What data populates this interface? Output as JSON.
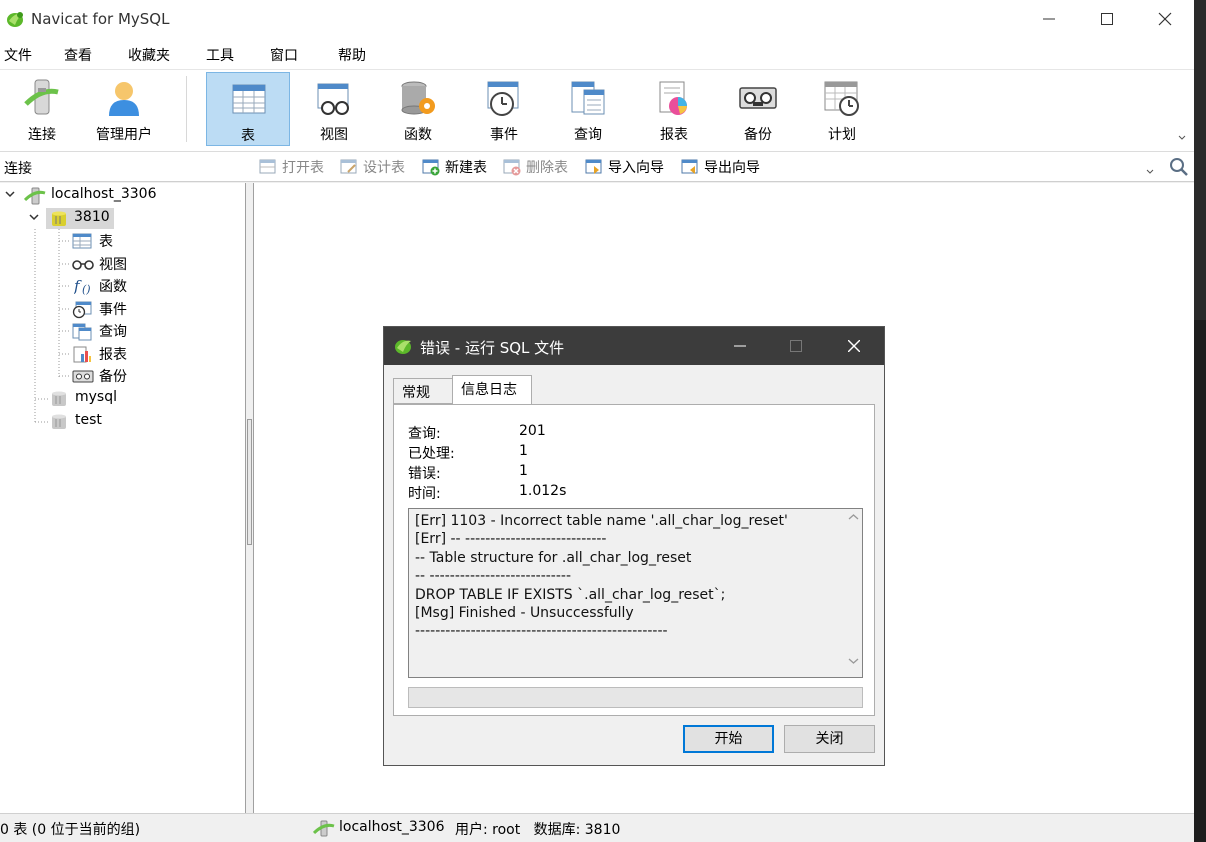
{
  "window": {
    "title": "Navicat for MySQL"
  },
  "menu": [
    "文件",
    "查看",
    "收藏夹",
    "工具",
    "窗口",
    "帮助"
  ],
  "toolbar": {
    "items": [
      {
        "label": "连接",
        "icon": "connection-icon"
      },
      {
        "label": "管理用户",
        "icon": "user-icon"
      },
      {
        "label": "表",
        "icon": "table-icon",
        "active": true
      },
      {
        "label": "视图",
        "icon": "view-icon"
      },
      {
        "label": "函数",
        "icon": "function-icon"
      },
      {
        "label": "事件",
        "icon": "event-icon"
      },
      {
        "label": "查询",
        "icon": "query-icon"
      },
      {
        "label": "报表",
        "icon": "report-icon"
      },
      {
        "label": "备份",
        "icon": "backup-icon"
      },
      {
        "label": "计划",
        "icon": "schedule-icon"
      }
    ]
  },
  "objectbar": {
    "connection_label": "连接",
    "buttons": [
      "打开表",
      "设计表",
      "新建表",
      "删除表",
      "导入向导",
      "导出向导"
    ]
  },
  "tree": {
    "connection": "localhost_3306",
    "database": "3810",
    "children": [
      "表",
      "视图",
      "函数",
      "事件",
      "查询",
      "报表",
      "备份"
    ],
    "other_dbs": [
      "mysql",
      "test"
    ]
  },
  "status": {
    "left": "0 表 (0 位于当前的组)",
    "connection": "localhost_3306",
    "user_db": "用户: root   数据库: 3810"
  },
  "dialog": {
    "title": "错误 - 运行 SQL 文件",
    "tabs": [
      "常规",
      "信息日志"
    ],
    "active_tab": "信息日志",
    "info": [
      {
        "key": "查询:",
        "value": "201"
      },
      {
        "key": "已处理:",
        "value": "1"
      },
      {
        "key": "错误:",
        "value": "1"
      },
      {
        "key": "时间:",
        "value": "1.012s"
      }
    ],
    "log": [
      "[Err] 1103 - Incorrect table name '.all_char_log_reset'",
      "[Err] -- ----------------------------",
      "-- Table structure for .all_char_log_reset",
      "-- ----------------------------",
      "DROP TABLE IF EXISTS `.all_char_log_reset`;",
      "[Msg] Finished - Unsuccessfully",
      "--------------------------------------------------"
    ],
    "progress": 0,
    "buttons": {
      "start": "开始",
      "close": "关闭"
    }
  }
}
